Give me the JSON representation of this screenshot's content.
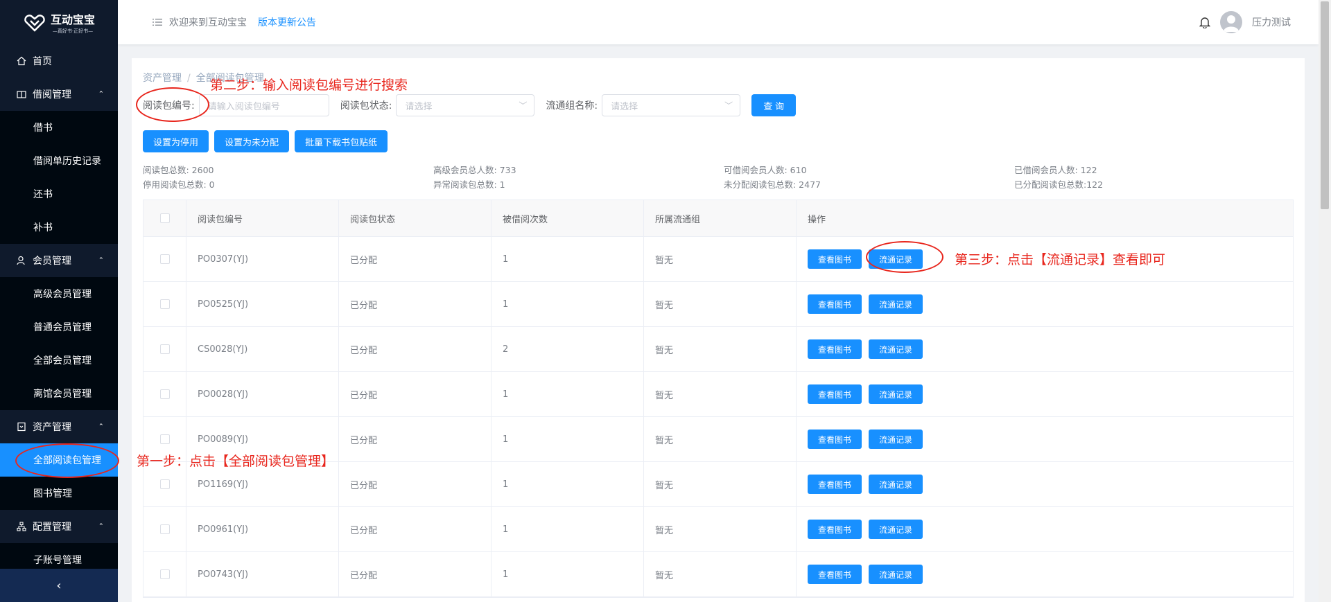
{
  "app": {
    "logo_title": "互动宝宝",
    "logo_sub": "—真好书·正好书—"
  },
  "sidebar": {
    "home": "首页",
    "groups": [
      {
        "label": "借阅管理",
        "items": [
          "借书",
          "借阅单历史记录",
          "还书",
          "补书"
        ]
      },
      {
        "label": "会员管理",
        "items": [
          "高级会员管理",
          "普通会员管理",
          "全部会员管理",
          "离馆会员管理"
        ]
      },
      {
        "label": "资产管理",
        "items": [
          "全部阅读包管理",
          "图书管理"
        ]
      },
      {
        "label": "配置管理",
        "items": [
          "子账号管理"
        ]
      }
    ],
    "collapse_icon": "chevron-left-icon"
  },
  "header": {
    "welcome": "欢迎来到互动宝宝",
    "notice": "版本更新公告",
    "username": "压力测试"
  },
  "breadcrumb": {
    "parent": "资产管理",
    "sep": "/",
    "current": "全部阅读包管理"
  },
  "filters": {
    "package_no_label": "阅读包编号:",
    "package_no_placeholder": "请输入阅读包编号",
    "status_label": "阅读包状态:",
    "status_placeholder": "请选择",
    "group_label": "流通组名称:",
    "group_placeholder": "请选择",
    "query_button": "查 询"
  },
  "actions": {
    "set_disabled": "设置为停用",
    "set_unassigned": "设置为未分配",
    "batch_download": "批量下载书包贴纸"
  },
  "stats": [
    [
      "阅读包总数: 2600",
      "停用阅读包总数: 0"
    ],
    [
      "高级会员总人数: 733",
      "异常阅读包总数: 1"
    ],
    [
      "可借阅会员人数: 610",
      "未分配阅读包总数: 2477"
    ],
    [
      "已借阅会员人数: 122",
      "已分配阅读包总数:122"
    ]
  ],
  "table": {
    "headers": [
      "阅读包编号",
      "阅读包状态",
      "被借阅次数",
      "所属流通组",
      "操作"
    ],
    "view_books": "查看图书",
    "flow_records": "流通记录",
    "rows": [
      {
        "code": "PO0307(YJ)",
        "status": "已分配",
        "count": "1",
        "group": "暂无"
      },
      {
        "code": "PO0525(YJ)",
        "status": "已分配",
        "count": "1",
        "group": "暂无"
      },
      {
        "code": "CS0028(YJ)",
        "status": "已分配",
        "count": "2",
        "group": "暂无"
      },
      {
        "code": "PO0028(YJ)",
        "status": "已分配",
        "count": "1",
        "group": "暂无"
      },
      {
        "code": "PO0089(YJ)",
        "status": "已分配",
        "count": "1",
        "group": "暂无"
      },
      {
        "code": "PO1169(YJ)",
        "status": "已分配",
        "count": "1",
        "group": "暂无"
      },
      {
        "code": "PO0961(YJ)",
        "status": "已分配",
        "count": "1",
        "group": "暂无"
      },
      {
        "code": "PO0743(YJ)",
        "status": "已分配",
        "count": "1",
        "group": "暂无"
      }
    ]
  },
  "annotations": {
    "step1": "第一步：点击【全部阅读包管理】",
    "step2": "第二步：输入阅读包编号进行搜索",
    "step3": "第三步：点击【流通记录】查看即可"
  },
  "colors": {
    "primary": "#1890ff",
    "sidebar_bg": "#0f1a2c",
    "annotation": "#e8261d"
  }
}
